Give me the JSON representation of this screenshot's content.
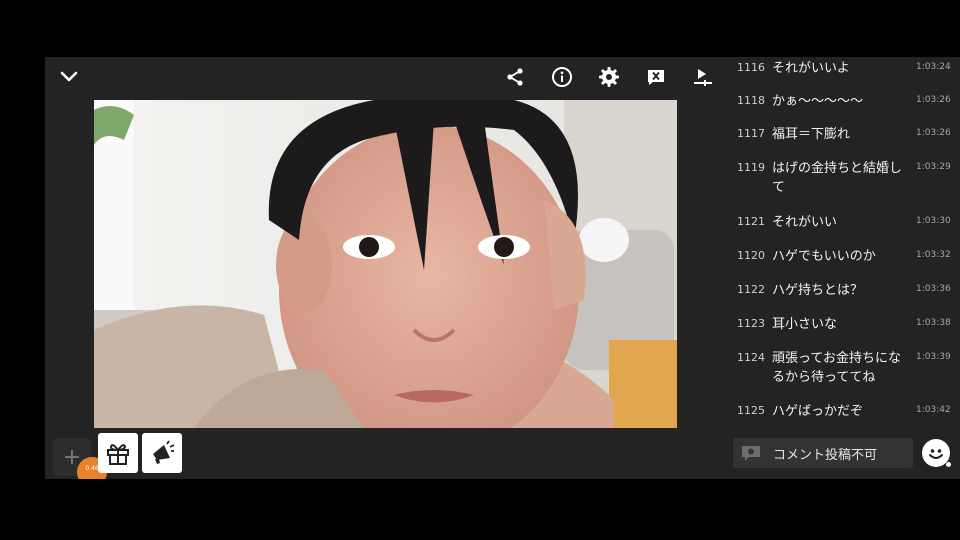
{
  "toolbar": {
    "collapse_icon": "chevron-down-icon",
    "icons": [
      "share-icon",
      "info-icon",
      "gear-icon",
      "close-box-icon",
      "sliders-icon"
    ]
  },
  "bottom": {
    "plus_label": "+",
    "badge_text": "0.46"
  },
  "comments": [
    {
      "num": "1116",
      "text": "それがいいよ",
      "time": "1:03:24"
    },
    {
      "num": "1118",
      "text": "かぁ〜〜〜〜〜",
      "time": "1:03:26"
    },
    {
      "num": "1117",
      "text": "福耳＝下膨れ",
      "time": "1:03:26"
    },
    {
      "num": "1119",
      "text": "はげの金持ちと結婚して",
      "time": "1:03:29"
    },
    {
      "num": "1121",
      "text": "それがいい",
      "time": "1:03:30"
    },
    {
      "num": "1120",
      "text": "ハゲでもいいのか",
      "time": "1:03:32"
    },
    {
      "num": "1122",
      "text": "ハゲ持ちとは？",
      "time": "1:03:36"
    },
    {
      "num": "1123",
      "text": "耳小さいな",
      "time": "1:03:38"
    },
    {
      "num": "1124",
      "text": "頑張ってお金持ちになるから待っててね",
      "time": "1:03:39"
    },
    {
      "num": "1125",
      "text": "ハゲばっかだぞ",
      "time": "1:03:42"
    }
  ],
  "comment_input": {
    "disabled_label": "コメント投稿不可"
  },
  "colors": {
    "background": "#000000",
    "panel": "#232323",
    "accent_badge": "#e8822a"
  }
}
